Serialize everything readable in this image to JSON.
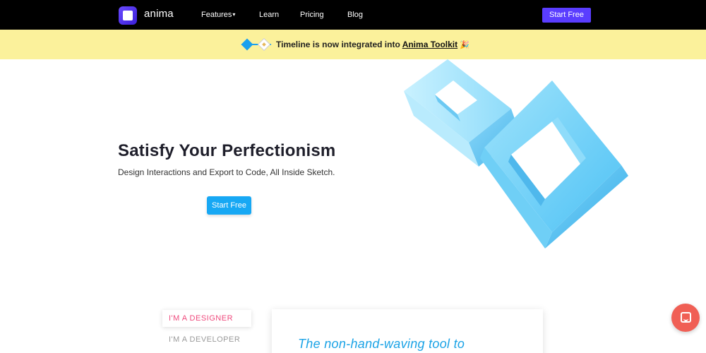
{
  "nav": {
    "logo_text": "anima",
    "links": [
      {
        "label": "Features"
      },
      {
        "label": "Learn"
      },
      {
        "label": "Pricing"
      },
      {
        "label": "Blog"
      }
    ],
    "cta_label": "Start Free"
  },
  "banner": {
    "text_prefix": "Timeline is now integrated into ",
    "link_text": "Anima Toolkit",
    "emoji": "🎉"
  },
  "hero": {
    "title": "Satisfy Your Perfectionism",
    "subtitle": "Design Interactions and Export to Code, All Inside Sketch.",
    "cta_label": "Start Free"
  },
  "tabs": [
    {
      "label": "I'M A DESIGNER",
      "active": true
    },
    {
      "label": "I'M A DEVELOPER",
      "active": false
    }
  ],
  "card": {
    "text": "The non-hand-waving tool to"
  },
  "colors": {
    "nav_bg": "#000000",
    "brand": "#5a3dff",
    "banner_bg": "#fbf19b",
    "cta_blue": "#17a8f4",
    "tab_active": "#ef4a7d",
    "chat": "#f05f55"
  },
  "icons": {
    "logo": "anima-logo-icon",
    "timeline": "timeline-icon",
    "chevron": "chevron-down-icon",
    "chat": "chat-icon",
    "hero_art": "impossible-cubes-illustration"
  }
}
